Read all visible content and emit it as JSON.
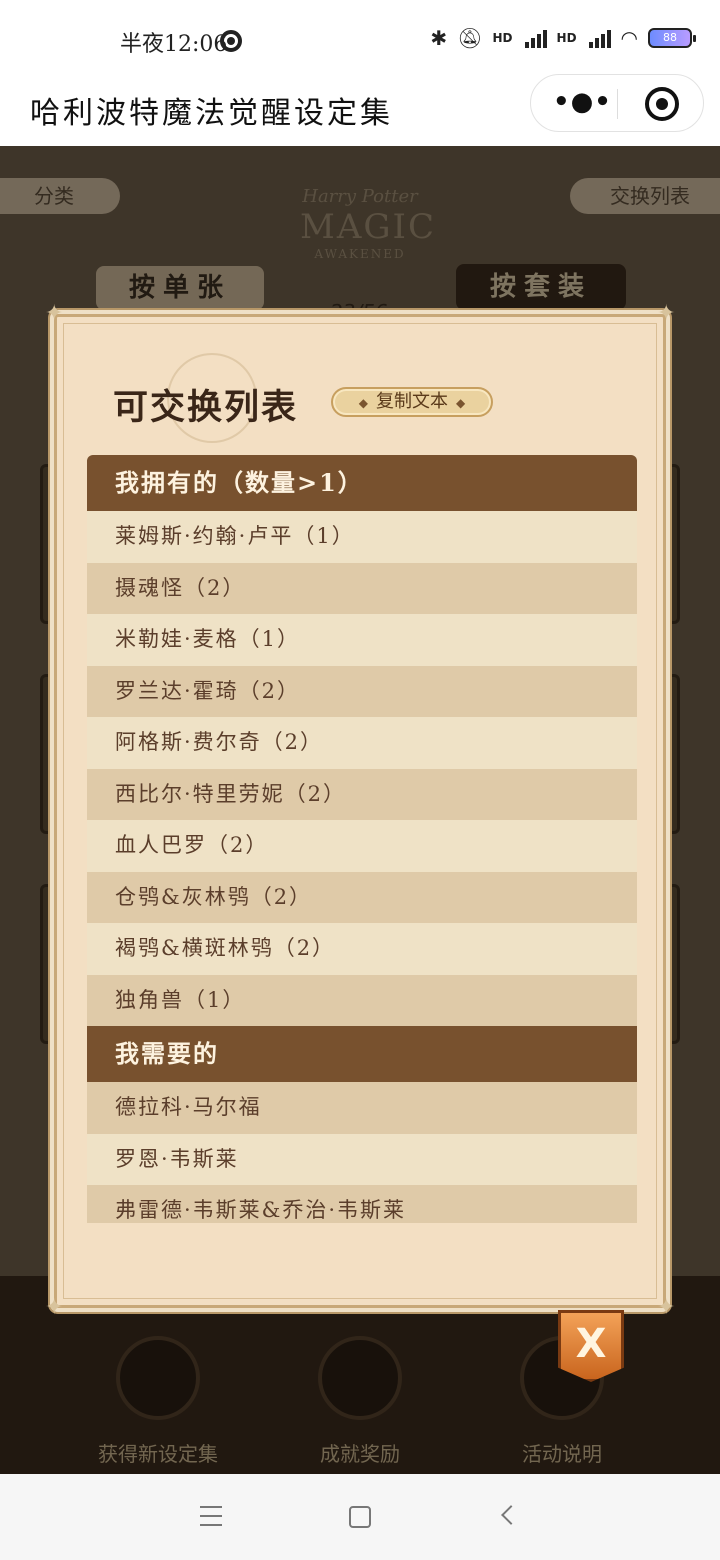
{
  "status_bar": {
    "time": "半夜12:06"
  },
  "app": {
    "title": "哈利波特魔法觉醒设定集",
    "capsule_menu_icon": "more-dots-icon",
    "capsule_close_icon": "miniapp-close-icon"
  },
  "background": {
    "tab_left": "分类",
    "tab_right": "交换列表",
    "logo_line1": "Harry Potter",
    "logo_line2": "MAGIC",
    "logo_line3": "AWAKENED",
    "btn_single": "按单张",
    "btn_set": "按套装",
    "count": "23/56",
    "bottom_buttons": [
      "获得新设定集",
      "成就奖励",
      "活动说明"
    ]
  },
  "modal": {
    "title": "可交换列表",
    "copy_button": "复制文本",
    "sections": [
      {
        "header": "我拥有的（数量>1）",
        "items": [
          "莱姆斯·约翰·卢平（1）",
          "摄魂怪（2）",
          "米勒娃·麦格（1）",
          "罗兰达·霍琦（2）",
          "阿格斯·费尔奇（2）",
          "西比尔·特里劳妮（2）",
          "血人巴罗（2）",
          "仓鸮&灰林鸮（2）",
          "褐鸮&横斑林鸮（2）",
          "独角兽（1）"
        ]
      },
      {
        "header": "我需要的",
        "items": [
          "德拉科·马尔福",
          "罗恩·韦斯莱",
          "弗雷德·韦斯莱&乔治·韦斯莱"
        ]
      }
    ],
    "close_label": "X"
  },
  "colors": {
    "section_header": "#78512e",
    "row_light": "#efe2c6",
    "row_dark": "#dfcaa8",
    "modal_bg": "#f3dfc3",
    "close_button": "#e0843a"
  }
}
